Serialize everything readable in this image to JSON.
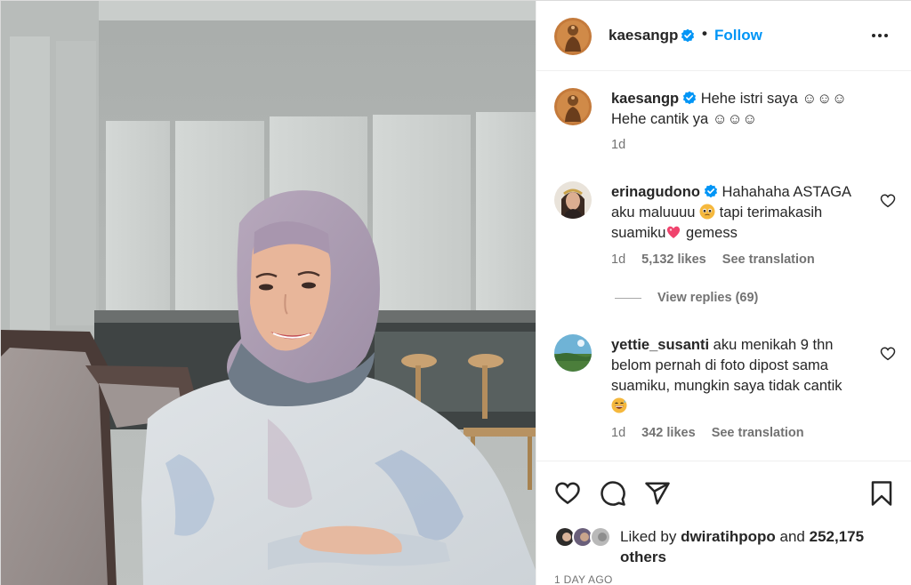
{
  "post": {
    "image_alt": "Photo of a smiling woman in a lavender hijab and floral dress seated in a modern room"
  },
  "header": {
    "username": "kaesangp",
    "separator": "•",
    "follow_label": "Follow",
    "more_icon": "more-horizontal-icon"
  },
  "caption": {
    "username": "kaesangp",
    "line1": "Hehe istri saya ☺☺☺",
    "line2": "Hehe cantik ya ☺☺☺",
    "time": "1d"
  },
  "comments": [
    {
      "username": "erinagudono",
      "verified": true,
      "text_part1": "Hahahaha ASTAGA",
      "text_part2": "aku maluuuu",
      "text_part3": "tapi terimakasih",
      "text_part4": "suamiku",
      "text_part5": "gemess",
      "emoji_1": "pleading-face-emoji",
      "emoji_2": "sparkling-heart-emoji",
      "time": "1d",
      "likes": "5,132 likes",
      "see_translation": "See translation",
      "view_replies": "View replies (69)"
    },
    {
      "username": "yettie_susanti",
      "verified": false,
      "text_line1": "aku menikah 9 thn",
      "text_line2": "belom pernah di foto dipost sama",
      "text_line3": "suamiku, mungkin saya tidak cantik",
      "emoji": "grinning-sweat-emoji",
      "time": "1d",
      "likes": "342 likes",
      "see_translation": "See translation"
    }
  ],
  "actions": {
    "like_icon": "heart-icon",
    "comment_icon": "comment-icon",
    "share_icon": "send-icon",
    "save_icon": "bookmark-icon"
  },
  "likes": {
    "prefix": "Liked by",
    "user": "dwiratihpopo",
    "middle": "and",
    "count": "252,175",
    "suffix": "others"
  },
  "timestamp": "1 DAY AGO",
  "colors": {
    "accent": "#0095f6",
    "verified": "#0095f6",
    "text": "#262626",
    "muted": "#737373"
  }
}
